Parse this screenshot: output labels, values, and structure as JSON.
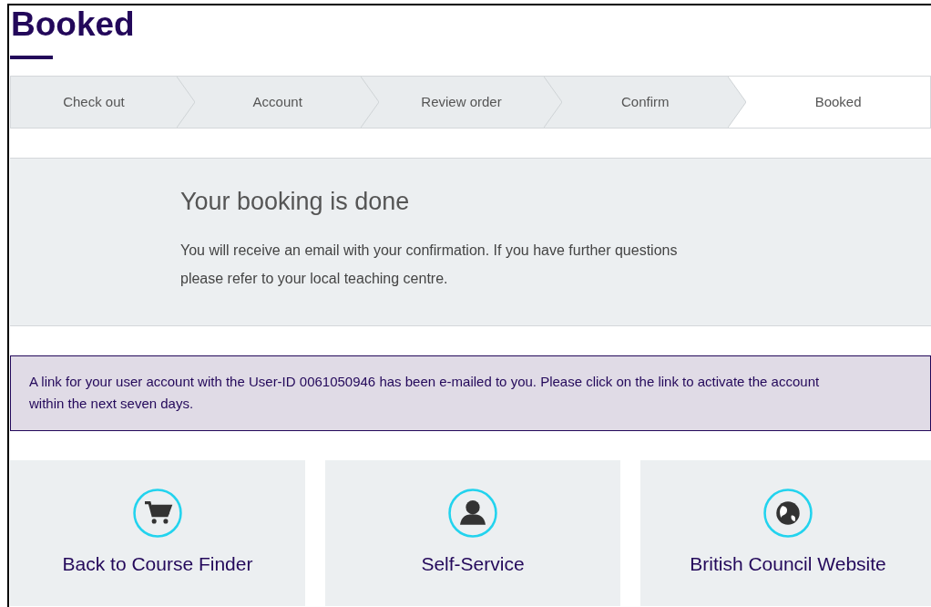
{
  "title": "Booked",
  "steps": [
    {
      "label": "Check out",
      "selected": false
    },
    {
      "label": "Account",
      "selected": false
    },
    {
      "label": "Review order",
      "selected": false
    },
    {
      "label": "Confirm",
      "selected": false
    },
    {
      "label": "Booked",
      "selected": true
    }
  ],
  "confirmation": {
    "heading": "Your booking is done",
    "text": "You will receive an email with your confirmation. If you have further questions please refer to your local teaching centre."
  },
  "notice": "A link for your user account with the User-ID 0061050946 has been e-mailed to you. Please click on the link to activate the account within the next seven days.",
  "links": [
    {
      "kind": "cart",
      "label": "Back to Course Finder"
    },
    {
      "kind": "person",
      "label": "Self-Service"
    },
    {
      "kind": "globe",
      "label": "British Council Website"
    }
  ]
}
